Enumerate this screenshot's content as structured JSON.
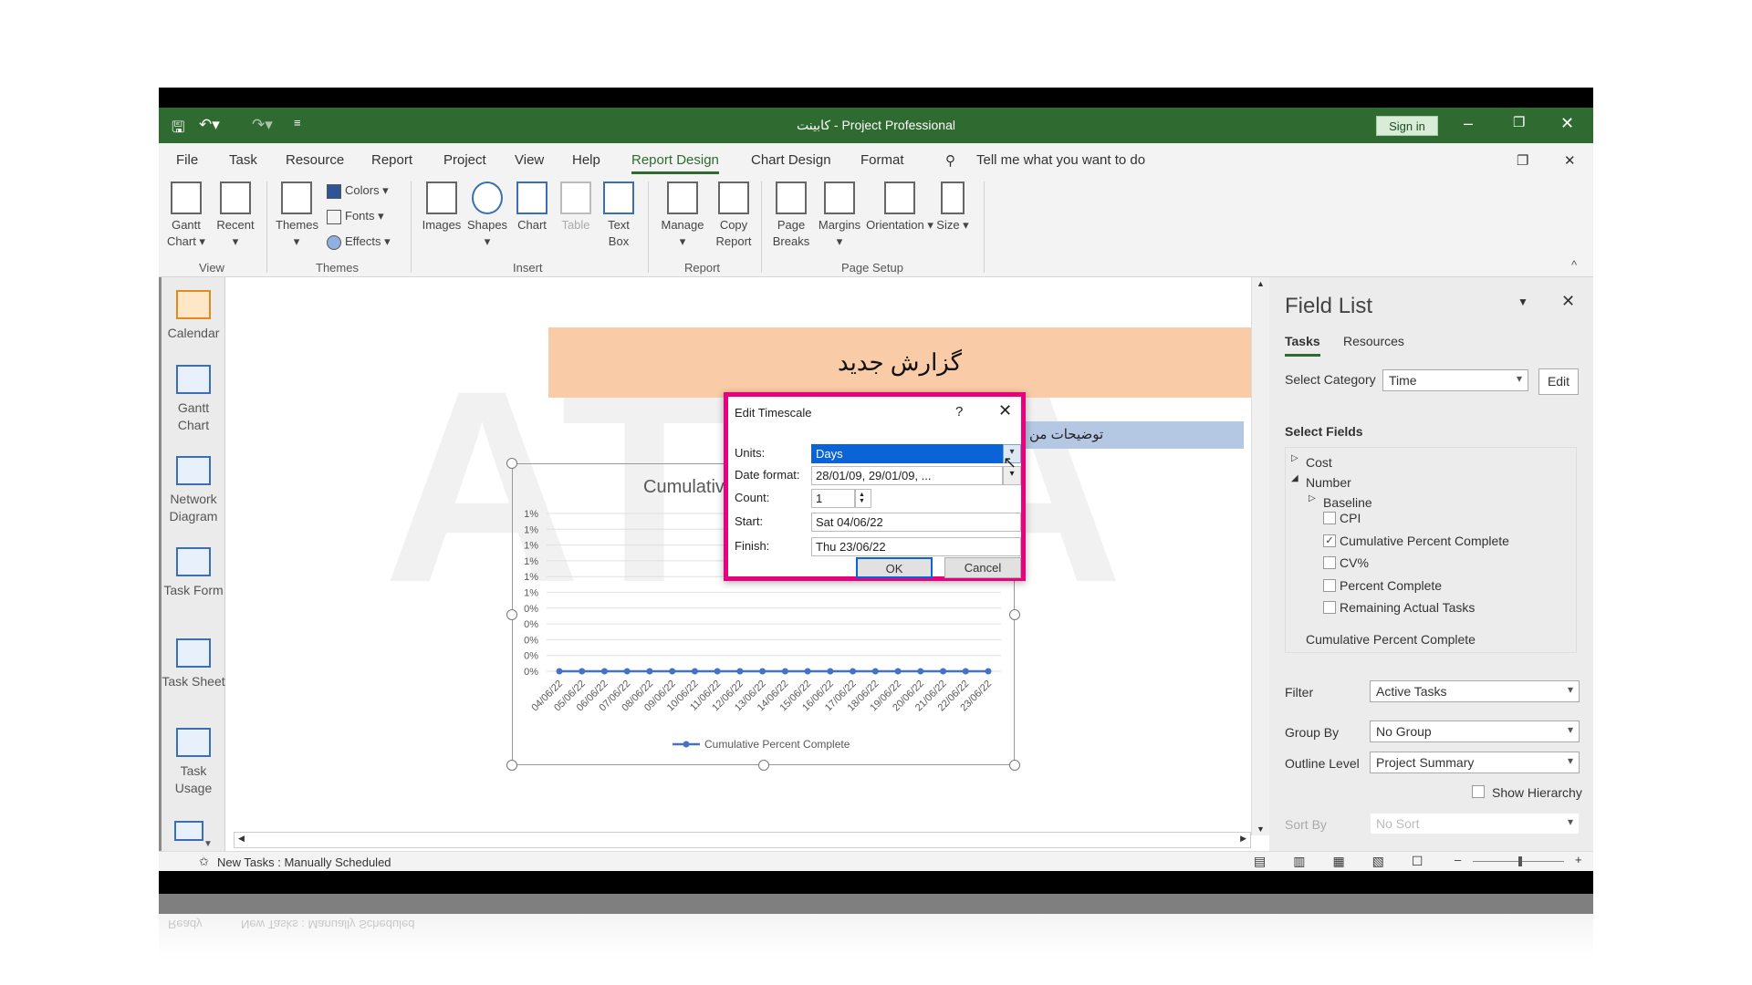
{
  "window": {
    "title": "کابینت  -  Project Professional",
    "sign_in": "Sign in"
  },
  "menu": {
    "tabs": [
      "File",
      "Task",
      "Resource",
      "Report",
      "Project",
      "View",
      "Help",
      "Report Design",
      "Chart Design",
      "Format"
    ],
    "active": "Report Design",
    "tell_me": "Tell me what you want to do"
  },
  "ribbon": {
    "view": {
      "gantt": "Gantt Chart ▾",
      "recent": "Recent ▾",
      "group": "View"
    },
    "themes": {
      "themes": "Themes ▾",
      "colors": "Colors ▾",
      "fonts": "Fonts ▾",
      "effects": "Effects ▾",
      "group": "Themes"
    },
    "insert": {
      "images": "Images",
      "shapes": "Shapes ▾",
      "chart": "Chart",
      "table": "Table",
      "textbox": "Text Box",
      "group": "Insert"
    },
    "report": {
      "manage": "Manage ▾",
      "copy": "Copy Report",
      "group": "Report"
    },
    "page_setup": {
      "breaks": "Page Breaks",
      "margins": "Margins ▾",
      "orientation": "Orientation ▾",
      "size": "Size ▾",
      "group": "Page Setup"
    }
  },
  "sidebar": {
    "items": [
      "Calendar",
      "Gantt Chart",
      "Network Diagram",
      "Task Form",
      "Task Sheet",
      "Task Usage"
    ]
  },
  "report": {
    "title": "گزارش جدید",
    "description": "توضیحات من",
    "chart_title": "Cumulativ"
  },
  "chart_data": {
    "type": "line",
    "title": "Cumulativ",
    "ytick_labels": [
      "1%",
      "1%",
      "1%",
      "1%",
      "1%",
      "1%",
      "0%",
      "0%",
      "0%",
      "0%",
      "0%"
    ],
    "categories": [
      "04/06/22",
      "05/06/22",
      "06/06/22",
      "07/06/22",
      "08/06/22",
      "09/06/22",
      "10/06/22",
      "11/06/22",
      "12/06/22",
      "13/06/22",
      "14/06/22",
      "15/06/22",
      "16/06/22",
      "17/06/22",
      "18/06/22",
      "19/06/22",
      "20/06/22",
      "21/06/22",
      "22/06/22",
      "23/06/22"
    ],
    "series": [
      {
        "name": "Cumulative Percent Complete",
        "values": [
          0,
          0,
          0,
          0,
          0,
          0,
          0,
          0,
          0,
          0,
          0,
          0,
          0,
          0,
          0,
          0,
          0,
          0,
          0,
          0
        ],
        "color": "#4472c4"
      }
    ],
    "grid": true,
    "legend": "bottom"
  },
  "dialog": {
    "title": "Edit Timescale",
    "help": "?",
    "units_label": "Units:",
    "units": "Days",
    "date_format_label": "Date format:",
    "date_format": "28/01/09, 29/01/09, ...",
    "count_label": "Count:",
    "count": "1",
    "start_label": "Start:",
    "start": "Sat 04/06/22",
    "finish_label": "Finish:",
    "finish": "Thu 23/06/22",
    "ok": "OK",
    "cancel": "Cancel"
  },
  "field_list": {
    "title": "Field List",
    "tabs": [
      "Tasks",
      "Resources"
    ],
    "select_category_label": "Select Category",
    "select_category": "Time",
    "edit": "Edit",
    "select_fields_label": "Select Fields",
    "tree": {
      "cost": "Cost",
      "number": "Number",
      "baseline": "Baseline"
    },
    "fields": [
      {
        "label": "CPI",
        "checked": false
      },
      {
        "label": "Cumulative Percent Complete",
        "checked": true
      },
      {
        "label": "CV%",
        "checked": false
      },
      {
        "label": "Percent Complete",
        "checked": false
      },
      {
        "label": "Remaining Actual Tasks",
        "checked": false
      }
    ],
    "selected_field": "Cumulative Percent Complete",
    "filter_label": "Filter",
    "filter": "Active Tasks",
    "group_by_label": "Group By",
    "group_by": "No Group",
    "outline_label": "Outline Level",
    "outline": "Project Summary",
    "show_hierarchy": "Show Hierarchy",
    "sort_by_label": "Sort By",
    "sort_by": "No Sort"
  },
  "status": {
    "new_tasks": "New Tasks : Manually Scheduled",
    "ready": "Ready"
  },
  "colors": {
    "accent": "#2f6a31",
    "dialog_highlight": "#e8007d",
    "report_header": "#f9cba7"
  }
}
